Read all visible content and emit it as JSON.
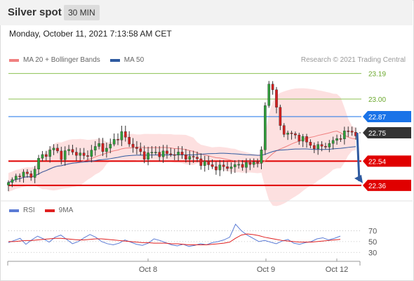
{
  "header": {
    "title": "Silver spot",
    "timeframe": "30 MIN"
  },
  "timestamp": "Monday, October 11, 2021 7:13:58 AM CET",
  "legend": {
    "items": [
      {
        "label": "MA 20 + Bollinger Bands",
        "color": "#f08080"
      },
      {
        "label": "MA 50",
        "color": "#2e5aa0"
      }
    ],
    "copyright": "Research © 2021 Trading Central"
  },
  "rsi_legend": {
    "items": [
      {
        "label": "RSI",
        "color": "#5b7bd5"
      },
      {
        "label": "9MA",
        "color": "#e02020"
      }
    ]
  },
  "chart_data": [
    {
      "type": "candlestick",
      "title": "Silver spot",
      "price_range": [
        22.25,
        23.24
      ],
      "levels": [
        {
          "value": 23.19,
          "label": "23.19",
          "kind": "resistance",
          "color": "#8cc152"
        },
        {
          "value": 23.0,
          "label": "23.00",
          "kind": "resistance",
          "color": "#8cc152"
        },
        {
          "value": 22.87,
          "label": "22.87",
          "kind": "pivot",
          "color": "#1a73e8"
        },
        {
          "value": 22.75,
          "label": "22.75",
          "kind": "last",
          "color": "#333333"
        },
        {
          "value": 22.54,
          "label": "22.54",
          "kind": "support",
          "color": "#e00000"
        },
        {
          "value": 22.36,
          "label": "22.36",
          "kind": "support",
          "color": "#e00000"
        }
      ],
      "x_ticks": [
        "Oct 8",
        "Oct 9",
        "Oct 12"
      ],
      "close_path": [
        [
          0,
          22.37
        ],
        [
          3,
          22.45
        ],
        [
          6,
          22.43
        ],
        [
          8,
          22.55
        ],
        [
          10,
          22.6
        ],
        [
          12,
          22.63
        ],
        [
          14,
          22.58
        ],
        [
          16,
          22.62
        ],
        [
          18,
          22.6
        ],
        [
          20,
          22.57
        ],
        [
          22,
          22.62
        ],
        [
          24,
          22.66
        ],
        [
          26,
          22.62
        ],
        [
          28,
          22.7
        ],
        [
          30,
          22.74
        ],
        [
          32,
          22.68
        ],
        [
          34,
          22.62
        ],
        [
          36,
          22.58
        ],
        [
          38,
          22.6
        ],
        [
          40,
          22.6
        ],
        [
          42,
          22.59
        ],
        [
          44,
          22.6
        ],
        [
          46,
          22.58
        ],
        [
          48,
          22.57
        ],
        [
          50,
          22.55
        ],
        [
          52,
          22.52
        ],
        [
          54,
          22.5
        ],
        [
          56,
          22.49
        ],
        [
          58,
          22.5
        ],
        [
          60,
          22.5
        ],
        [
          62,
          22.52
        ],
        [
          64,
          22.51
        ],
        [
          66,
          22.55
        ],
        [
          67,
          22.6
        ],
        [
          68,
          22.95
        ],
        [
          69,
          23.12
        ],
        [
          70,
          23.08
        ],
        [
          71,
          22.92
        ],
        [
          72,
          22.8
        ],
        [
          73,
          22.76
        ],
        [
          74,
          22.74
        ],
        [
          76,
          22.73
        ],
        [
          78,
          22.7
        ],
        [
          80,
          22.66
        ],
        [
          82,
          22.64
        ],
        [
          84,
          22.66
        ],
        [
          86,
          22.68
        ],
        [
          88,
          22.73
        ],
        [
          90,
          22.76
        ],
        [
          92,
          22.75
        ]
      ],
      "annotation": {
        "type": "arrow",
        "from": 22.75,
        "to": 22.36,
        "color": "#2e5aa0"
      }
    },
    {
      "type": "line",
      "title": "RSI",
      "y_ticks": [
        70,
        50,
        30
      ],
      "ylim": [
        20,
        90
      ],
      "series": [
        {
          "name": "RSI",
          "color": "#5b7bd5",
          "values": [
            48,
            52,
            56,
            45,
            53,
            60,
            55,
            49,
            58,
            62,
            54,
            46,
            50,
            57,
            63,
            58,
            50,
            46,
            44,
            47,
            53,
            49,
            45,
            43,
            47,
            55,
            52,
            48,
            44,
            42,
            45,
            41,
            43,
            46,
            44,
            48,
            50,
            53,
            58,
            82,
            70,
            62,
            56,
            50,
            52,
            49,
            46,
            51,
            54,
            47,
            45,
            48,
            50,
            55,
            57,
            53,
            56,
            60
          ]
        },
        {
          "name": "9MA",
          "color": "#e02020",
          "values": [
            50,
            50,
            51,
            52,
            52,
            53,
            54,
            55,
            56,
            56,
            55,
            54,
            53,
            53,
            54,
            55,
            55,
            54,
            53,
            52,
            51,
            50,
            49,
            48,
            48,
            47,
            47,
            47,
            46,
            46,
            45,
            44,
            44,
            44,
            44,
            45,
            46,
            47,
            49,
            56,
            62,
            64,
            63,
            61,
            58,
            56,
            54,
            52,
            51,
            50,
            49,
            49,
            49,
            50,
            51,
            52,
            53,
            54
          ]
        }
      ]
    }
  ]
}
